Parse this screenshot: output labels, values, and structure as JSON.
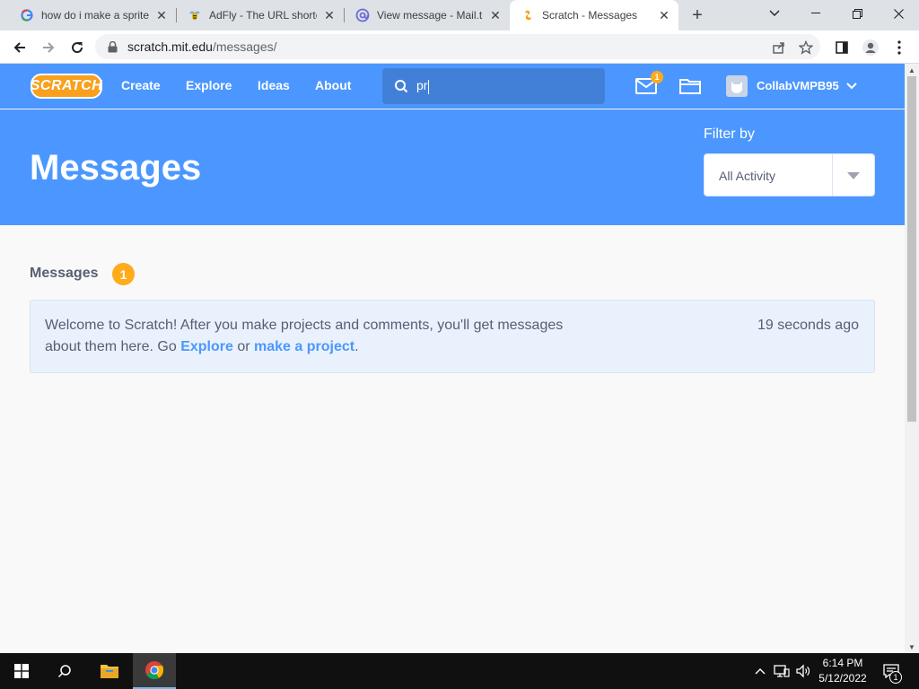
{
  "browser": {
    "tabs": [
      {
        "title": "how do i make a sprite",
        "icon": "google-icon"
      },
      {
        "title": "AdFly - The URL shorte",
        "icon": "adfly-icon"
      },
      {
        "title": "View message - Mail.tm",
        "icon": "mail-tm-icon"
      },
      {
        "title": "Scratch - Messages",
        "icon": "scratch-icon",
        "active": true
      }
    ],
    "url_host": "scratch.mit.edu",
    "url_path": "/messages/"
  },
  "scratch": {
    "logo": "SCRATCH",
    "nav": {
      "create": "Create",
      "explore": "Explore",
      "ideas": "Ideas",
      "about": "About"
    },
    "search_value": "pr",
    "mail_badge": "1",
    "username": "CollabVMPB95"
  },
  "banner": {
    "title": "Messages",
    "filter_label": "Filter by",
    "filter_value": "All Activity"
  },
  "messages": {
    "section_title": "Messages",
    "count": "1",
    "items": [
      {
        "text_before": "Welcome to Scratch! After you make projects and comments, you'll get messages about them here. Go ",
        "link_explore": "Explore",
        "text_between": " or ",
        "link_project": "make a project",
        "text_after": ".",
        "time": "19 seconds ago"
      }
    ]
  },
  "taskbar": {
    "time": "6:14 PM",
    "date": "5/12/2022",
    "notification_count": "1"
  },
  "colors": {
    "scratch_blue": "#4c97ff",
    "badge_orange": "#ffab1a",
    "text_gray": "#575e75"
  }
}
